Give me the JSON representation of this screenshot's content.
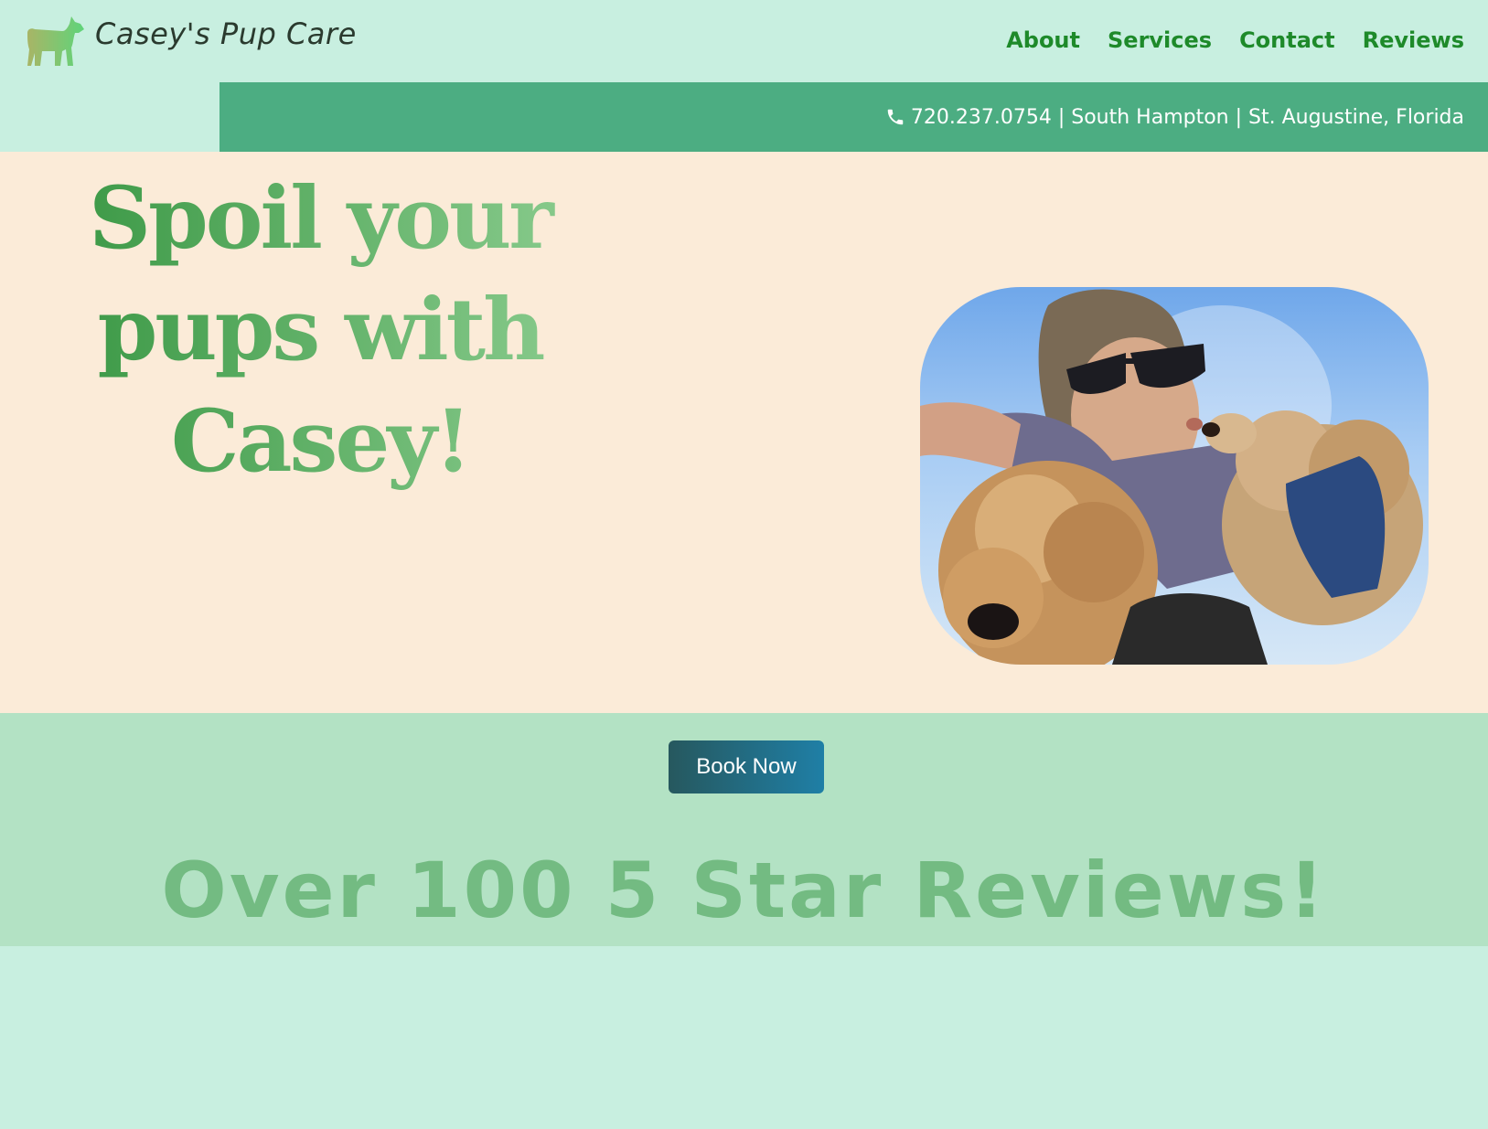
{
  "header": {
    "brand": "Casey's Pup Care",
    "logo_icon": "dog-silhouette-icon",
    "nav": [
      {
        "label": "About"
      },
      {
        "label": "Services"
      },
      {
        "label": "Contact"
      },
      {
        "label": "Reviews"
      }
    ]
  },
  "infobar": {
    "phone_icon": "phone-icon",
    "text": "720.237.0754 | South Hampton | St. Augustine, Florida"
  },
  "hero": {
    "headline_line1": "Spoil your",
    "headline_line2": "pups with",
    "headline_line3": "Casey!",
    "photo_icon": "casey-with-two-doodles-photo"
  },
  "cta": {
    "book_label": "Book Now"
  },
  "reviews": {
    "headline": "Over 100 5 Star Reviews!"
  },
  "colors": {
    "page_bg": "#c8efe0",
    "nav_text": "#1e8a2a",
    "infobar_bg": "#4cad82",
    "hero_bg": "#fbebd8",
    "cta_band_bg": "#b3e2c4",
    "headline_green": "#3e9a48",
    "reviews_green": "#73bb82"
  }
}
